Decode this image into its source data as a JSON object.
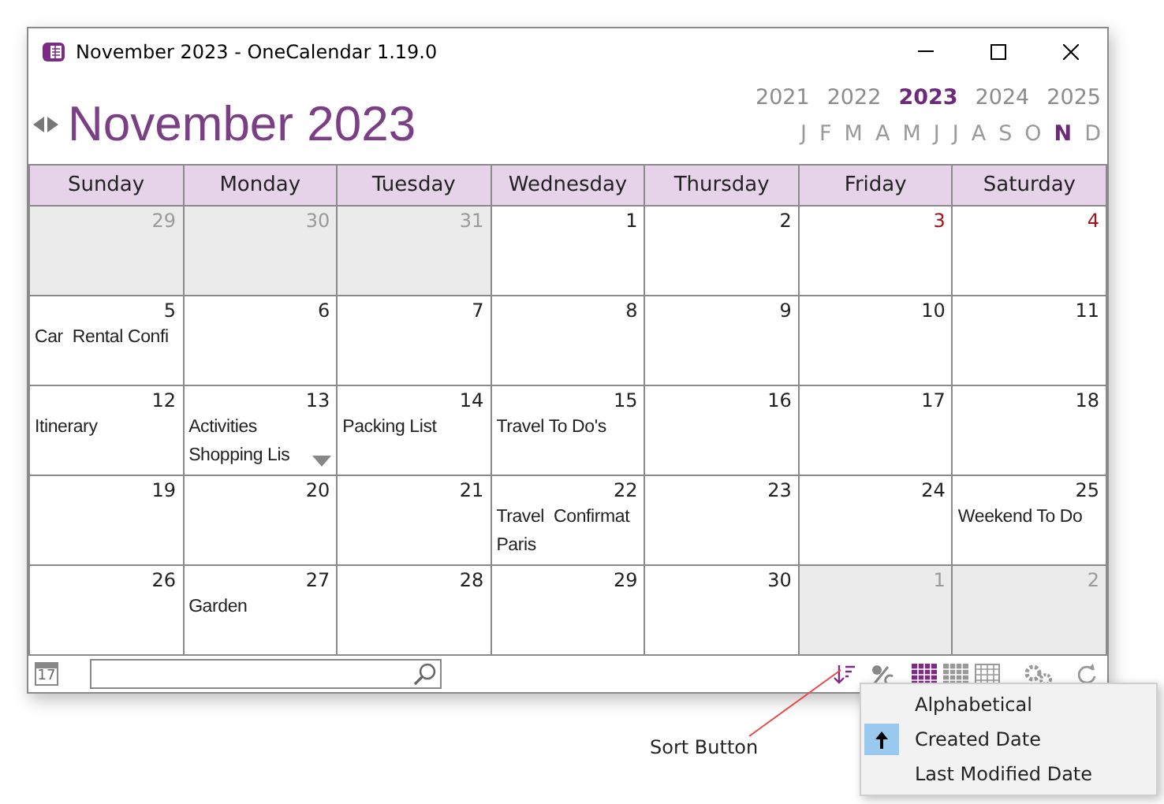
{
  "window": {
    "title": "November 2023 - OneCalendar 1.19.0"
  },
  "header": {
    "title": "November 2023"
  },
  "years": [
    {
      "label": "2021",
      "selected": false
    },
    {
      "label": "2022",
      "selected": false
    },
    {
      "label": "2023",
      "selected": true
    },
    {
      "label": "2024",
      "selected": false
    },
    {
      "label": "2025",
      "selected": false
    }
  ],
  "months": [
    {
      "label": "J",
      "selected": false
    },
    {
      "label": "F",
      "selected": false
    },
    {
      "label": "M",
      "selected": false
    },
    {
      "label": "A",
      "selected": false
    },
    {
      "label": "M",
      "selected": false
    },
    {
      "label": "J",
      "selected": false
    },
    {
      "label": "J",
      "selected": false
    },
    {
      "label": "A",
      "selected": false
    },
    {
      "label": "S",
      "selected": false
    },
    {
      "label": "O",
      "selected": false
    },
    {
      "label": "N",
      "selected": true
    },
    {
      "label": "D",
      "selected": false
    }
  ],
  "weekdays": [
    "Sunday",
    "Monday",
    "Tuesday",
    "Wednesday",
    "Thursday",
    "Friday",
    "Saturday"
  ],
  "weeks": [
    [
      {
        "day": "29",
        "kind": "other"
      },
      {
        "day": "30",
        "kind": "other"
      },
      {
        "day": "31",
        "kind": "other"
      },
      {
        "day": "1",
        "kind": "normal"
      },
      {
        "day": "2",
        "kind": "normal"
      },
      {
        "day": "3",
        "kind": "holiday"
      },
      {
        "day": "4",
        "kind": "holiday"
      }
    ],
    [
      {
        "day": "5",
        "kind": "normal",
        "notes": [
          "Car  Rental Confi"
        ]
      },
      {
        "day": "6",
        "kind": "normal"
      },
      {
        "day": "7",
        "kind": "normal"
      },
      {
        "day": "8",
        "kind": "normal"
      },
      {
        "day": "9",
        "kind": "normal"
      },
      {
        "day": "10",
        "kind": "normal"
      },
      {
        "day": "11",
        "kind": "normal"
      }
    ],
    [
      {
        "day": "12",
        "kind": "normal",
        "notes": [
          "Itinerary"
        ]
      },
      {
        "day": "13",
        "kind": "normal",
        "notes": [
          "Activities",
          "Shopping Lis"
        ],
        "more": true
      },
      {
        "day": "14",
        "kind": "normal",
        "notes": [
          "Packing List"
        ]
      },
      {
        "day": "15",
        "kind": "normal",
        "notes": [
          "Travel To Do's"
        ]
      },
      {
        "day": "16",
        "kind": "normal"
      },
      {
        "day": "17",
        "kind": "normal"
      },
      {
        "day": "18",
        "kind": "normal"
      }
    ],
    [
      {
        "day": "19",
        "kind": "normal"
      },
      {
        "day": "20",
        "kind": "normal"
      },
      {
        "day": "21",
        "kind": "normal"
      },
      {
        "day": "22",
        "kind": "normal",
        "notes": [
          "Travel  Confirmat",
          "Paris"
        ]
      },
      {
        "day": "23",
        "kind": "normal"
      },
      {
        "day": "24",
        "kind": "normal"
      },
      {
        "day": "25",
        "kind": "normal",
        "notes": [
          "Weekend To Do"
        ]
      }
    ],
    [
      {
        "day": "26",
        "kind": "normal"
      },
      {
        "day": "27",
        "kind": "normal",
        "notes": [
          "Garden"
        ]
      },
      {
        "day": "28",
        "kind": "normal"
      },
      {
        "day": "29",
        "kind": "normal"
      },
      {
        "day": "30",
        "kind": "normal"
      },
      {
        "day": "1",
        "kind": "other"
      },
      {
        "day": "2",
        "kind": "other"
      }
    ]
  ],
  "toolbar": {
    "today_icon_label": "17"
  },
  "sort_menu": {
    "items": [
      {
        "label": "Alphabetical",
        "selected": false
      },
      {
        "label": "Created Date",
        "selected": true
      },
      {
        "label": "Last Modified Date",
        "selected": false
      }
    ]
  },
  "callout": {
    "label": "Sort Button"
  }
}
